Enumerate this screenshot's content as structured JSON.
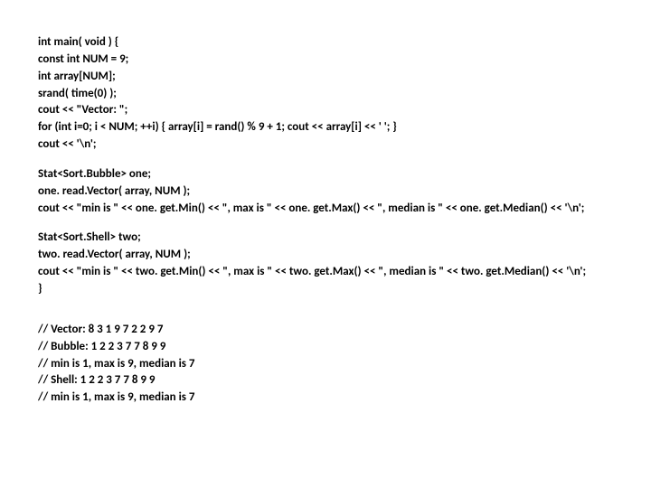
{
  "code": {
    "block1": [
      "int main( void ) {",
      "const int NUM = 9;",
      "int array[NUM];",
      "srand( time(0) );",
      "cout << \"Vector: \";",
      "for (int i=0; i < NUM; ++i) { array[i] = rand() % 9 + 1; cout << array[i] << ' '; }",
      "cout << '\\n';"
    ],
    "block2": [
      "Stat<Sort.Bubble> one;",
      "one. read.Vector( array, NUM );",
      "cout << \"min is \" << one. get.Min() << \", max is \" << one. get.Max() << \", median is \" << one. get.Median() << '\\n';"
    ],
    "block3": [
      "Stat<Sort.Shell> two;",
      "two. read.Vector( array, NUM );",
      "cout << \"min is \" << two. get.Min() << \", max is \" << two. get.Max() << \", median is \" << two. get.Median() << '\\n';",
      "}"
    ],
    "output": [
      "// Vector: 8 3 1 9 7 2 2 9 7",
      "// Bubble: 1 2 2 3 7 7 8 9 9",
      "// min is 1, max is 9, median is 7",
      "// Shell: 1 2 2 3 7 7 8 9 9",
      "// min is 1, max is 9, median is 7"
    ]
  }
}
